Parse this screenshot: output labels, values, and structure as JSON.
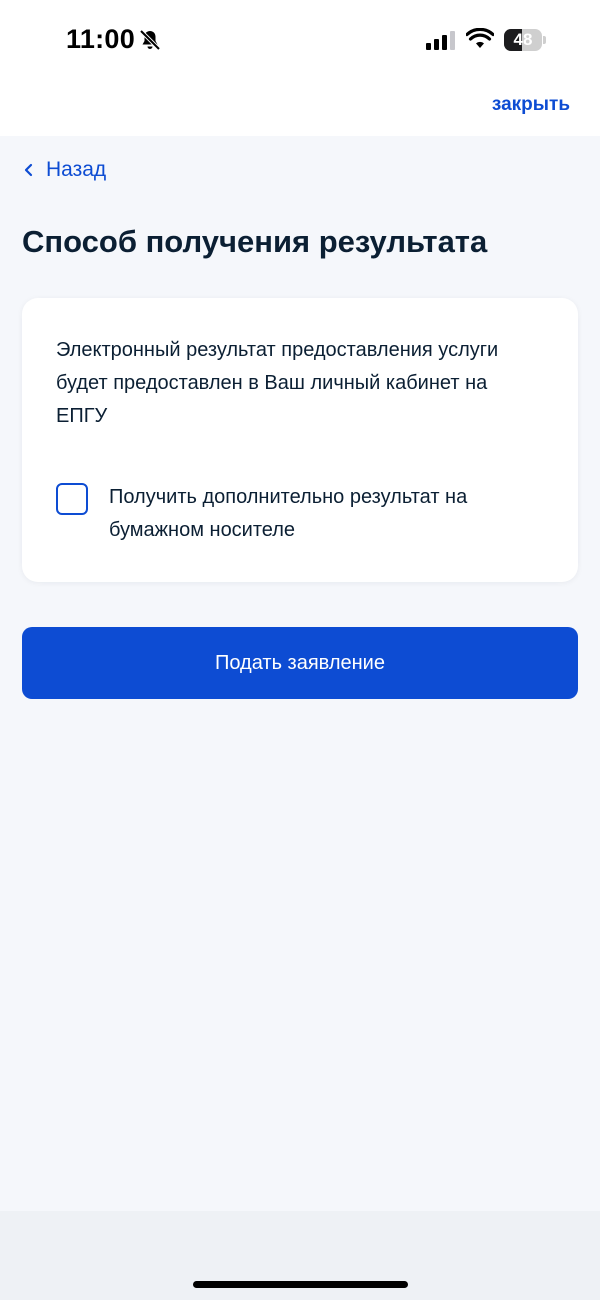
{
  "status_bar": {
    "time": "11:00",
    "battery_level": "48",
    "battery_fraction": 0.48,
    "icons": [
      "bell-slash-icon",
      "signal-icon",
      "wifi-icon",
      "battery-icon"
    ]
  },
  "header": {
    "close_label": "закрыть"
  },
  "nav": {
    "back_label": "Назад"
  },
  "page": {
    "title": "Способ получения результата"
  },
  "card": {
    "info_text": "Электронный результат предоставления услуги будет предоставлен в Ваш личный кабинет на ЕПГУ",
    "checkbox": {
      "label": "Получить дополнительно результат на бумажном носителе",
      "checked": false
    }
  },
  "actions": {
    "submit_label": "Подать заявление"
  },
  "colors": {
    "accent": "#0d4cd3",
    "text": "#0b1f33",
    "background": "#f5f7fb",
    "card": "#ffffff"
  }
}
